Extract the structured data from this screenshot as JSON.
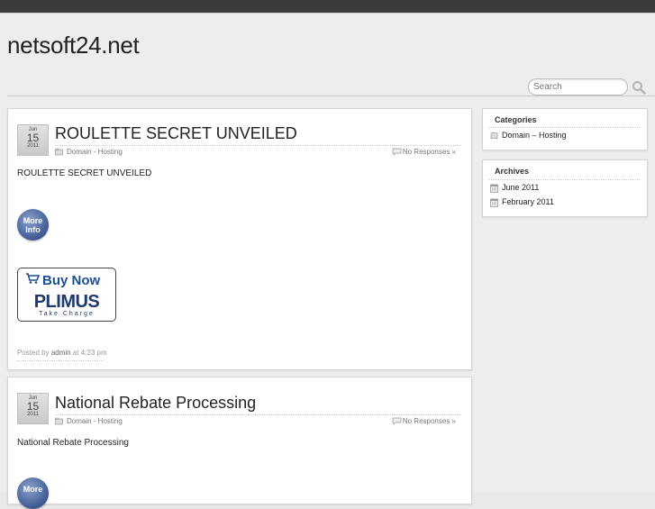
{
  "site": {
    "title": "netsoft24.net"
  },
  "search": {
    "placeholder": "Search"
  },
  "posts": [
    {
      "month": "Jun",
      "day": "15",
      "year": "2011",
      "title": "ROULETTE SECRET UNVEILED",
      "category": "Domain - Hosting",
      "responses": "No Responses »",
      "body": "ROULETTE SECRET UNVEILED",
      "more_info": {
        "line1": "More",
        "line2": "Info"
      },
      "buy_now": {
        "label": "Buy Now",
        "brand": "PLIMUS",
        "tagline": "Take Charge"
      },
      "posted_by_prefix": "Posted by",
      "author": "admin",
      "time": "at 4:23 pm"
    },
    {
      "month": "Jun",
      "day": "15",
      "year": "2011",
      "title": "National Rebate Processing",
      "category": "Domain - Hosting",
      "responses": "No Responses »",
      "body": "National Rebate Processing",
      "more_info": {
        "line1": "More"
      }
    }
  ],
  "sidebar": {
    "categories": {
      "title": "Categories",
      "items": [
        "Domain – Hosting"
      ]
    },
    "archives": {
      "title": "Archives",
      "items": [
        "June 2011",
        "February 2011"
      ]
    }
  },
  "colors": {
    "topbar": "#3b3b3b",
    "background": "#ededed",
    "more_info": "#3e5a92",
    "plimus": "#1d4f91"
  },
  "icons": {
    "search": "magnifier-icon",
    "category": "folder-icon",
    "responses": "comment-icon",
    "archive": "calendar-icon"
  }
}
